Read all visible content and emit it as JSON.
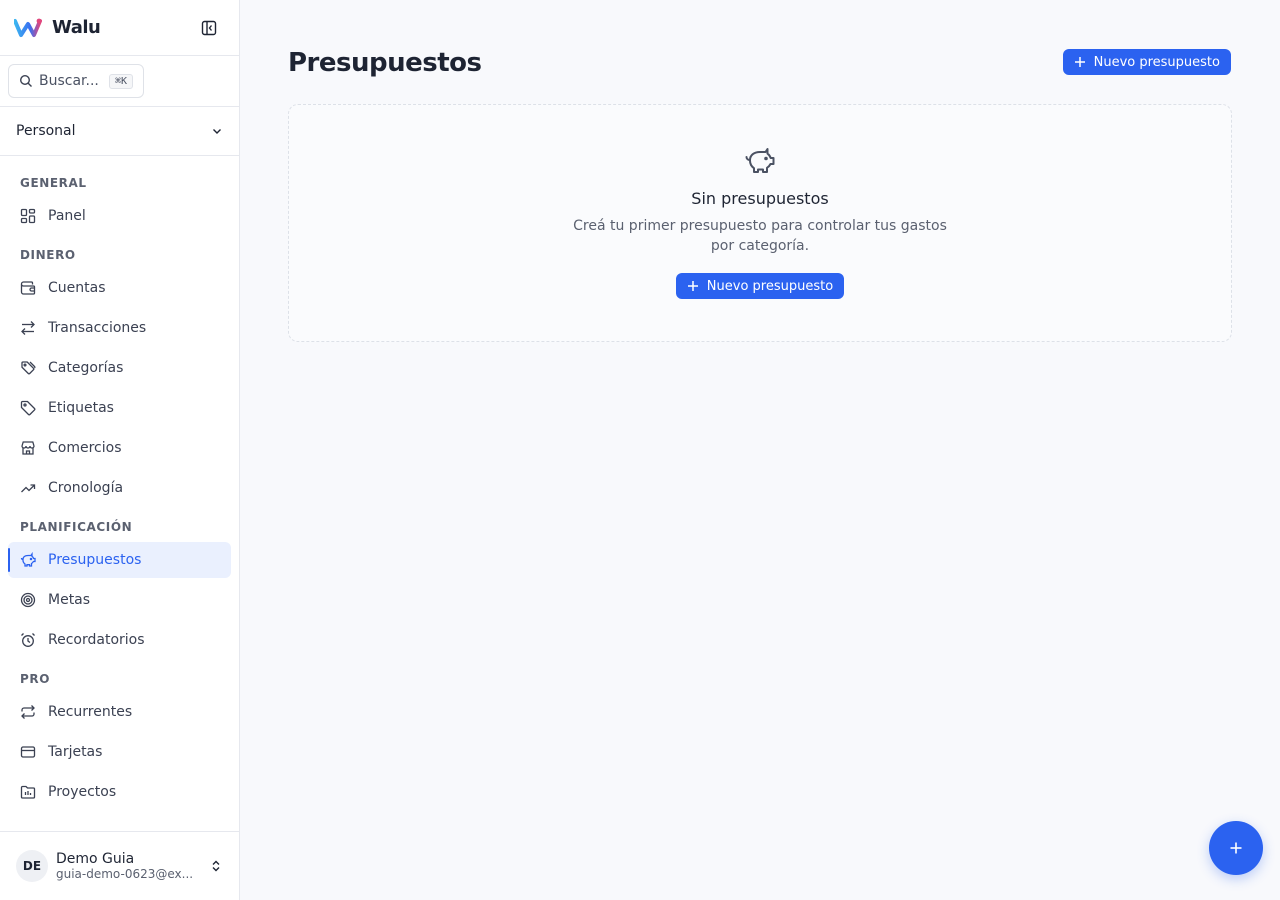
{
  "app": {
    "name": "Walu",
    "accent_color": "#2b62f0"
  },
  "search": {
    "placeholder": "Buscar...",
    "shortcut": "⌘K"
  },
  "workspace": {
    "selected": "Personal"
  },
  "nav": {
    "general": {
      "title": "GENERAL",
      "items": [
        {
          "label": "Panel",
          "icon": "grid-icon"
        }
      ]
    },
    "dinero": {
      "title": "DINERO",
      "items": [
        {
          "label": "Cuentas",
          "icon": "wallet-icon"
        },
        {
          "label": "Transacciones",
          "icon": "arrows-swap-icon"
        },
        {
          "label": "Categorías",
          "icon": "tags-icon"
        },
        {
          "label": "Etiquetas",
          "icon": "tag-icon"
        },
        {
          "label": "Comercios",
          "icon": "store-icon"
        },
        {
          "label": "Cronología",
          "icon": "trend-up-icon"
        }
      ]
    },
    "planificacion": {
      "title": "PLANIFICACIÓN",
      "items": [
        {
          "label": "Presupuestos",
          "icon": "piggy-bank-icon",
          "active": true
        },
        {
          "label": "Metas",
          "icon": "target-icon"
        },
        {
          "label": "Recordatorios",
          "icon": "alarm-clock-icon"
        }
      ]
    },
    "pro": {
      "title": "PRO",
      "items": [
        {
          "label": "Recurrentes",
          "icon": "repeat-icon"
        },
        {
          "label": "Tarjetas",
          "icon": "credit-card-icon"
        },
        {
          "label": "Proyectos",
          "icon": "folder-chart-icon"
        }
      ]
    }
  },
  "user": {
    "initials": "DE",
    "name": "Demo Guia",
    "email": "guia-demo-0623@ex..."
  },
  "main": {
    "title": "Presupuestos",
    "new_button_label": "Nuevo presupuesto",
    "empty": {
      "title": "Sin presupuestos",
      "description": "Creá tu primer presupuesto para controlar tus gastos por categoría.",
      "button_label": "Nuevo presupuesto"
    }
  }
}
